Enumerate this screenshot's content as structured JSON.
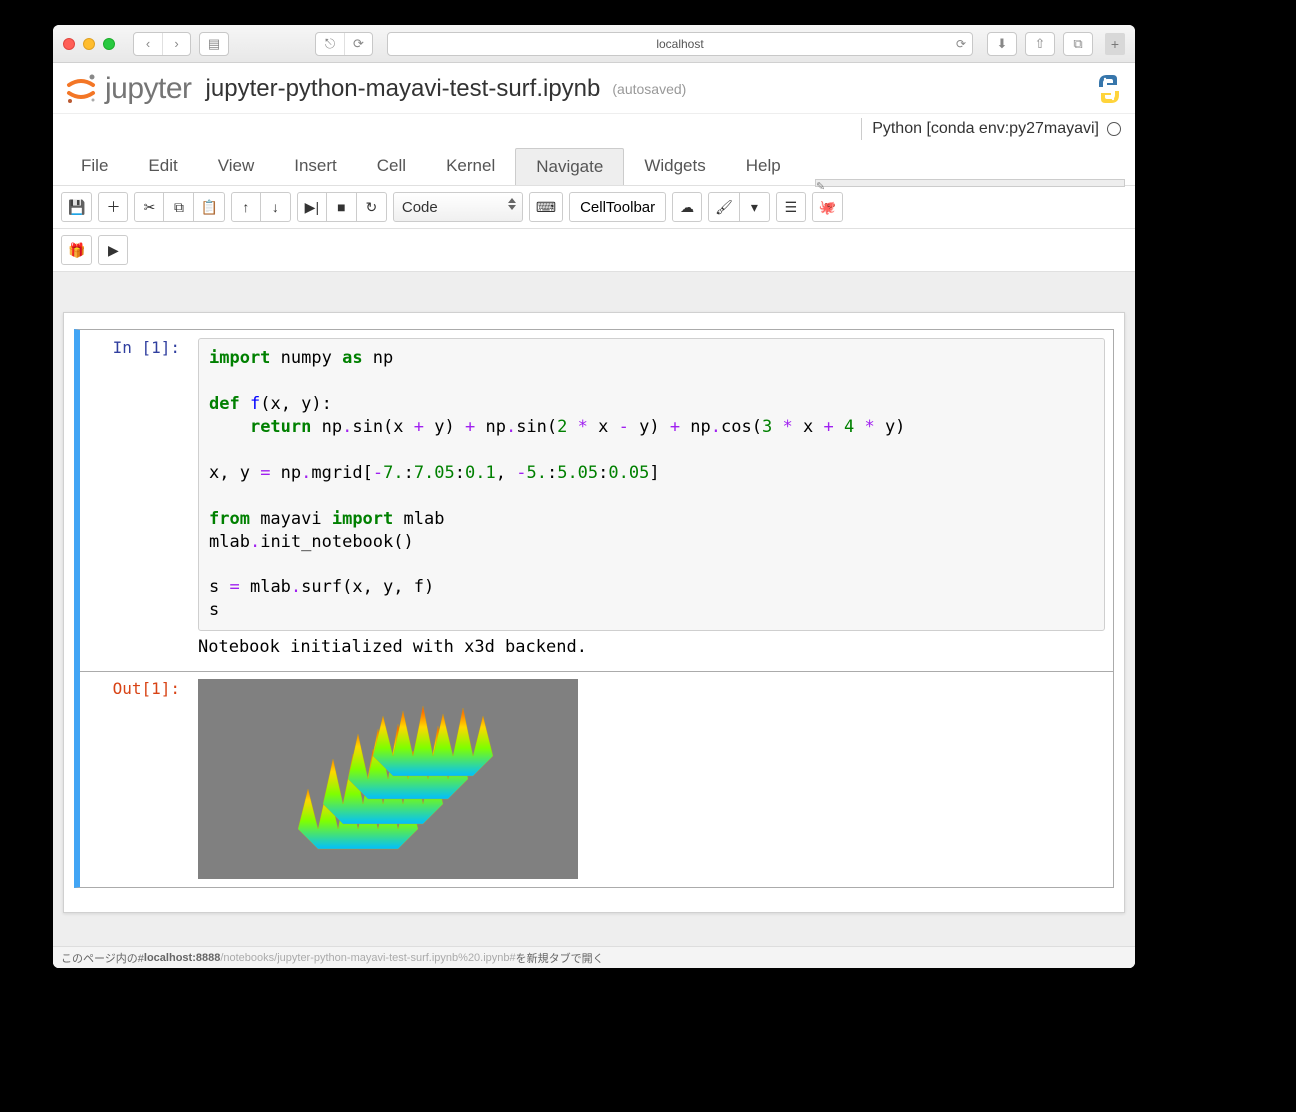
{
  "browser": {
    "address": "localhost",
    "traffic": [
      "close",
      "minimize",
      "maximize"
    ]
  },
  "header": {
    "logo_text": "jupyter",
    "notebook_title": "jupyter-python-mayavi-test-surf.ipynb",
    "autosaved": "(autosaved)"
  },
  "kernel": {
    "name": "Python [conda env:py27mayavi]"
  },
  "menubar": {
    "items": [
      "File",
      "Edit",
      "View",
      "Insert",
      "Cell",
      "Kernel",
      "Navigate",
      "Widgets",
      "Help"
    ],
    "active_index": 6
  },
  "toolbar": {
    "cell_type": "Code",
    "cell_toolbar": "CellToolbar"
  },
  "cell": {
    "in_prompt": "In [1]:",
    "out_prompt": "Out[1]:",
    "code_lines": [
      [
        [
          "kw",
          "import"
        ],
        [
          "",
          " numpy "
        ],
        [
          "kw",
          "as"
        ],
        [
          "",
          " np"
        ]
      ],
      [],
      [
        [
          "kw",
          "def"
        ],
        [
          "",
          " "
        ],
        [
          "fn",
          "f"
        ],
        [
          "",
          "(x, y):"
        ]
      ],
      [
        [
          "",
          "    "
        ],
        [
          "kw",
          "return"
        ],
        [
          "",
          " np"
        ],
        [
          "op",
          "."
        ],
        [
          "",
          "sin(x "
        ],
        [
          "op",
          "+"
        ],
        [
          "",
          " y) "
        ],
        [
          "op",
          "+"
        ],
        [
          "",
          " np"
        ],
        [
          "op",
          "."
        ],
        [
          "",
          "sin("
        ],
        [
          "num",
          "2"
        ],
        [
          "",
          " "
        ],
        [
          "op",
          "*"
        ],
        [
          "",
          " x "
        ],
        [
          "op",
          "-"
        ],
        [
          "",
          " y) "
        ],
        [
          "op",
          "+"
        ],
        [
          "",
          " np"
        ],
        [
          "op",
          "."
        ],
        [
          "",
          "cos("
        ],
        [
          "num",
          "3"
        ],
        [
          "",
          " "
        ],
        [
          "op",
          "*"
        ],
        [
          "",
          " x "
        ],
        [
          "op",
          "+"
        ],
        [
          "",
          " "
        ],
        [
          "num",
          "4"
        ],
        [
          "",
          " "
        ],
        [
          "op",
          "*"
        ],
        [
          "",
          " y)"
        ]
      ],
      [],
      [
        [
          "",
          "x, y "
        ],
        [
          "op",
          "="
        ],
        [
          "",
          " np"
        ],
        [
          "op",
          "."
        ],
        [
          "",
          "mgrid["
        ],
        [
          "op",
          "-"
        ],
        [
          "num",
          "7."
        ],
        [
          "",
          ":"
        ],
        [
          "num",
          "7.05"
        ],
        [
          "",
          ":"
        ],
        [
          "num",
          "0.1"
        ],
        [
          "",
          ", "
        ],
        [
          "op",
          "-"
        ],
        [
          "num",
          "5."
        ],
        [
          "",
          ":"
        ],
        [
          "num",
          "5.05"
        ],
        [
          "",
          ":"
        ],
        [
          "num",
          "0.05"
        ],
        [
          "",
          "]"
        ]
      ],
      [],
      [
        [
          "kw",
          "from"
        ],
        [
          "",
          " mayavi "
        ],
        [
          "kw",
          "import"
        ],
        [
          "",
          " mlab"
        ]
      ],
      [
        [
          "",
          "mlab"
        ],
        [
          "op",
          "."
        ],
        [
          "",
          "init_notebook()"
        ]
      ],
      [],
      [
        [
          "",
          "s "
        ],
        [
          "op",
          "="
        ],
        [
          "",
          " mlab"
        ],
        [
          "op",
          "."
        ],
        [
          "",
          "surf(x, y, f)"
        ]
      ],
      [
        [
          "",
          "s"
        ]
      ]
    ],
    "output_text": "Notebook initialized with x3d backend."
  },
  "statusbar": {
    "prefix": "このページ内の#",
    "bold": "localhost:8888",
    "path": "/notebooks/jupyter-python-mayavi-test-surf.ipynb%20.ipynb#",
    "suffix": "を新規タブで開く"
  }
}
